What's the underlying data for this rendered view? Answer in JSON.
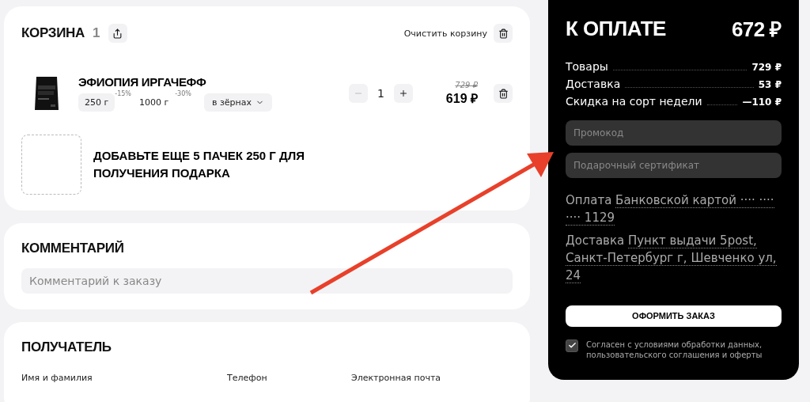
{
  "cart": {
    "title": "КОРЗИНА",
    "count": "1",
    "clear_label": "Очистить корзину",
    "items": [
      {
        "name": "ЭФИОПИЯ ИРГАЧЕФФ",
        "weights": [
          {
            "label": "250 г",
            "discount": "-15%",
            "selected": true
          },
          {
            "label": "1000 г",
            "discount": "-30%",
            "selected": false
          }
        ],
        "grind": "в зёрнах",
        "quantity": "1",
        "minus_disabled": true,
        "old_price": "729 ₽",
        "price": "619 ₽"
      }
    ],
    "gift_hint": "ДОБАВЬТЕ ЕЩЕ 5 ПАЧЕК 250 Г ДЛЯ ПОЛУЧЕНИЯ ПОДАРКА"
  },
  "comment": {
    "title": "КОММЕНТАРИЙ",
    "placeholder": "Комментарий к заказу"
  },
  "recipient": {
    "title": "ПОЛУЧАТЕЛЬ",
    "fields": [
      "Имя и фамилия",
      "Телефон",
      "Электронная почта"
    ]
  },
  "summary": {
    "title": "К ОПЛАТЕ",
    "total": "672 ₽",
    "lines": [
      {
        "label": "Товары",
        "value": "729 ₽"
      },
      {
        "label": "Доставка",
        "value": "53 ₽"
      },
      {
        "label": "Скидка на сорт недели",
        "value": "—110 ₽"
      }
    ],
    "promo_placeholder": "Промокод",
    "certificate_placeholder": "Подарочный сертификат",
    "payment": {
      "label": "Оплата",
      "value": "Банковской картой ···· ···· ···· 1129"
    },
    "delivery": {
      "label": "Доставка",
      "value": "Пункт выдачи 5post, Санкт-Петербург г, Шевченко ул, 24"
    },
    "submit": "ОФОРМИТЬ ЗАКАЗ",
    "agree": {
      "checked": true,
      "label": "Согласен с условиями обработки данных, пользовательского соглашения и оферты"
    }
  }
}
